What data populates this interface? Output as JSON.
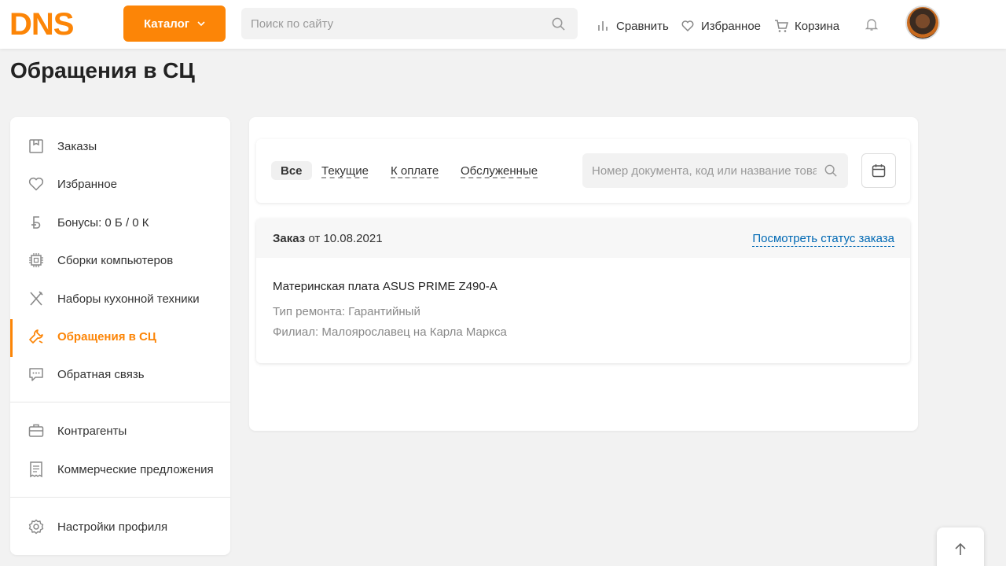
{
  "colors": {
    "accent": "#fc8507",
    "link": "#0069b4"
  },
  "header": {
    "logo_text": "DNS",
    "catalog_label": "Каталог",
    "search_placeholder": "Поиск по сайту",
    "compare_label": "Сравнить",
    "favorites_label": "Избранное",
    "cart_label": "Корзина"
  },
  "page": {
    "title": "Обращения в СЦ"
  },
  "sidebar": {
    "items": [
      {
        "label": "Заказы",
        "icon": "box-icon"
      },
      {
        "label": "Избранное",
        "icon": "heart-icon"
      },
      {
        "label": "Бонусы: 0 Б / 0 К",
        "icon": "bonus-icon"
      },
      {
        "label": "Сборки компьютеров",
        "icon": "chip-icon"
      },
      {
        "label": "Наборы кухонной техники",
        "icon": "fork-knife-icon"
      },
      {
        "label": "Обращения в СЦ",
        "icon": "wrench-icon",
        "active": true
      },
      {
        "label": "Обратная связь",
        "icon": "chat-icon"
      },
      {
        "label": "Контрагенты",
        "icon": "briefcase-icon"
      },
      {
        "label": "Коммерческие предложения",
        "icon": "receipt-icon"
      },
      {
        "label": "Настройки профиля",
        "icon": "gear-icon"
      }
    ]
  },
  "filters": {
    "tabs": [
      "Все",
      "Текущие",
      "К оплате",
      "Обслуженные"
    ],
    "selected": "Все",
    "search_placeholder": "Номер документа, код или название товара"
  },
  "order": {
    "label": "Заказ",
    "date_text": "от 10.08.2021",
    "status_link": "Посмотреть статус заказа",
    "product": "Материнская плата ASUS PRIME Z490-A",
    "repair_type": "Тип ремонта: Гарантийный",
    "branch": "Филиал: Малоярославец на Карла Маркса"
  }
}
